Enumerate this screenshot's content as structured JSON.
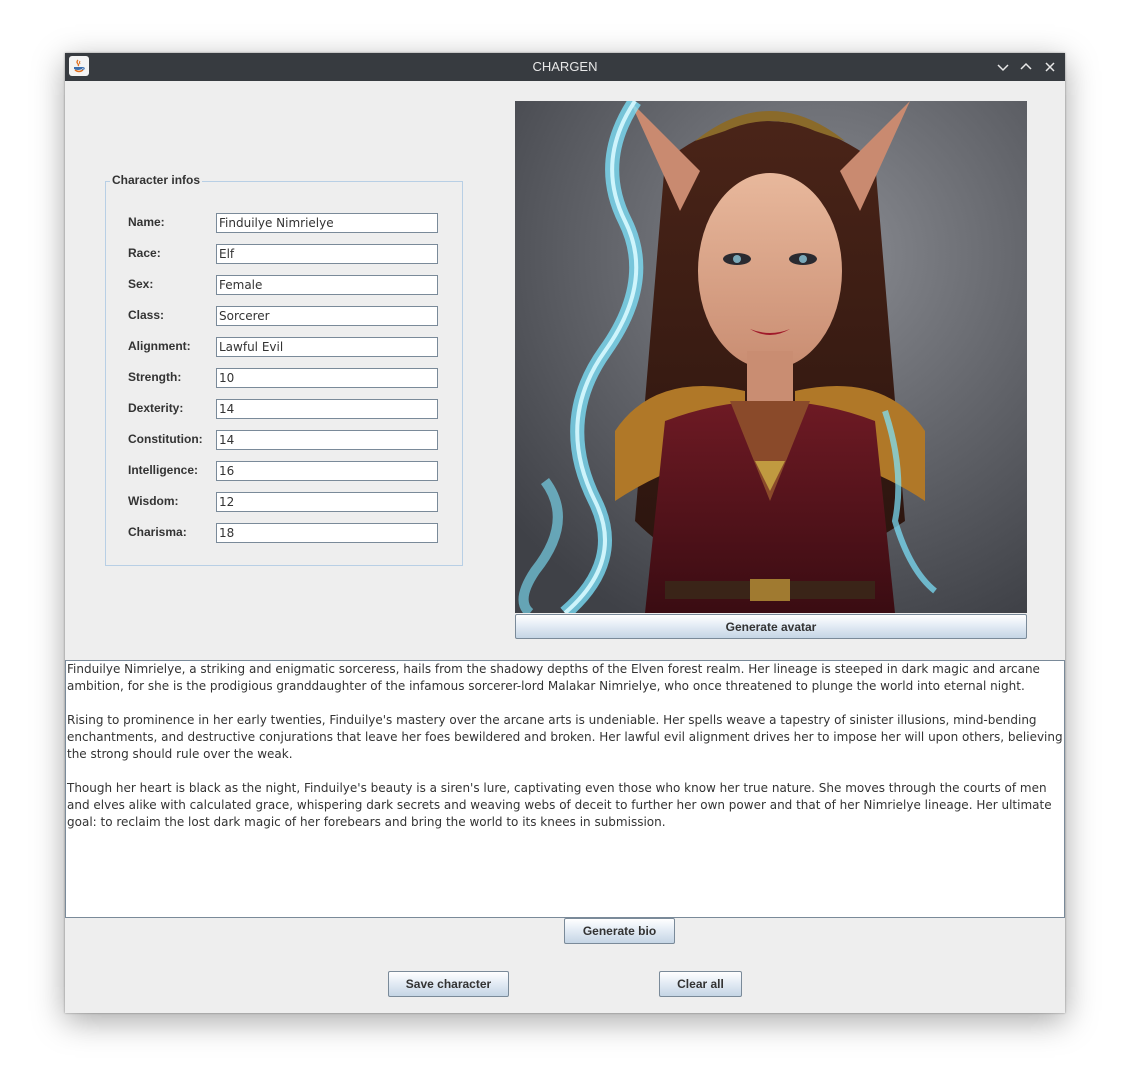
{
  "window": {
    "title": "CHARGEN"
  },
  "character_infos": {
    "legend": "Character infos",
    "fields": [
      {
        "label": "Name:",
        "value": "Finduilye Nimrielye"
      },
      {
        "label": "Race:",
        "value": "Elf"
      },
      {
        "label": "Sex:",
        "value": "Female"
      },
      {
        "label": "Class:",
        "value": "Sorcerer"
      },
      {
        "label": "Alignment:",
        "value": "Lawful Evil"
      },
      {
        "label": "Strength:",
        "value": "10"
      },
      {
        "label": "Dexterity:",
        "value": "14"
      },
      {
        "label": "Constitution:",
        "value": "14"
      },
      {
        "label": "Intelligence:",
        "value": "16"
      },
      {
        "label": "Wisdom:",
        "value": "12"
      },
      {
        "label": "Charisma:",
        "value": "18"
      }
    ]
  },
  "avatar": {
    "generate_label": "Generate avatar"
  },
  "bio": {
    "paragraphs": [
      "Finduilye Nimrielye, a striking and enigmatic sorceress, hails from the shadowy depths of the Elven forest realm. Her lineage is steeped in dark magic and arcane ambition, for she is the prodigious granddaughter of the infamous sorcerer-lord Malakar Nimrielye, who once threatened to plunge the world into eternal night.",
      "Rising to prominence in her early twenties, Finduilye's mastery over the arcane arts is undeniable. Her spells weave a tapestry of sinister illusions, mind-bending enchantments, and destructive conjurations that leave her foes bewildered and broken. Her lawful evil alignment drives her to impose her will upon others, believing the strong should rule over the weak.",
      "Though her heart is black as the night, Finduilye's beauty is a siren's lure, captivating even those who know her true nature. She moves through the courts of men and elves alike with calculated grace, whispering dark secrets and weaving webs of deceit to further her own power and that of her Nimrielye lineage. Her ultimate goal: to reclaim the lost dark magic of her forebears and bring the world to its knees in submission."
    ],
    "generate_label": "Generate bio"
  },
  "actions": {
    "save_label": "Save character",
    "clear_label": "Clear all"
  },
  "colors": {
    "titlebar": "#373b40",
    "window_bg": "#eeeeee",
    "group_border": "#b8cfe5"
  }
}
